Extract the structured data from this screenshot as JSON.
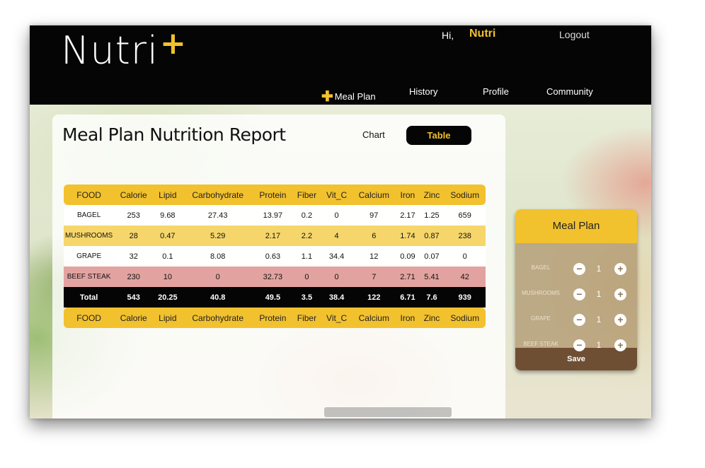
{
  "header": {
    "logo_text": "Nutri",
    "logo_plus": "+",
    "greeting": "Hi,",
    "username": "Nutri",
    "logout": "Logout",
    "nav": [
      {
        "label": "Meal Plan",
        "icon": "plus-icon"
      },
      {
        "label": "History"
      },
      {
        "label": "Profile"
      },
      {
        "label": "Community"
      }
    ]
  },
  "report": {
    "title": "Meal Plan Nutrition Report",
    "view_chart": "Chart",
    "view_table": "Table",
    "columns": [
      "FOOD",
      "Calorie",
      "Lipid",
      "Carbohydrate",
      "Protein",
      "Fiber",
      "Vit_C",
      "Calcium",
      "Iron",
      "Zinc",
      "Sodium"
    ],
    "rows": [
      [
        "BAGEL",
        "253",
        "9.68",
        "27.43",
        "13.97",
        "0.2",
        "0",
        "97",
        "2.17",
        "1.25",
        "659"
      ],
      [
        "MUSHROOMS",
        "28",
        "0.47",
        "5.29",
        "2.17",
        "2.2",
        "4",
        "6",
        "1.74",
        "0.87",
        "238"
      ],
      [
        "GRAPE",
        "32",
        "0.1",
        "8.08",
        "0.63",
        "1.1",
        "34.4",
        "12",
        "0.09",
        "0.07",
        "0"
      ],
      [
        "BEEF STEAK",
        "230",
        "10",
        "0",
        "32.73",
        "0",
        "0",
        "7",
        "2.71",
        "5.41",
        "42"
      ]
    ],
    "total": [
      "Total",
      "543",
      "20.25",
      "40.8",
      "49.5",
      "3.5",
      "38.4",
      "122",
      "6.71",
      "7.6",
      "939"
    ]
  },
  "meal_plan": {
    "title": "Meal Plan",
    "items": [
      {
        "name": "BAGEL",
        "qty": "1"
      },
      {
        "name": "MUSHROOMS",
        "qty": "1"
      },
      {
        "name": "GRAPE",
        "qty": "1"
      },
      {
        "name": "BEEF STEAK",
        "qty": "1"
      }
    ],
    "minus": "−",
    "plus": "+",
    "save": "Save"
  },
  "colors": {
    "accent": "#f2c12e",
    "header_bg": "#050505",
    "save_bg": "#6f4f33",
    "red_row": "#e2a3a0"
  }
}
